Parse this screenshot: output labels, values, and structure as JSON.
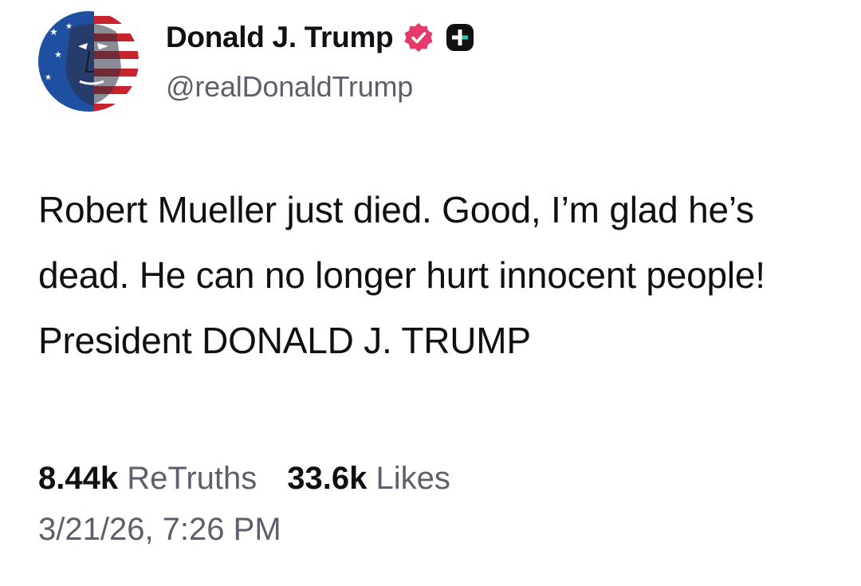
{
  "author": {
    "name": "Donald J. Trump",
    "handle": "@realDonaldTrump",
    "verified_icon": "verified-badge-icon",
    "plus_icon": "plus-badge-icon",
    "accent_color": "#e8396b"
  },
  "post": {
    "text": "Robert Mueller just died. Good, I’m glad he’s dead. He can no longer hurt innocent people! President DONALD J. TRUMP"
  },
  "stats": {
    "retruths_count": "8.44k",
    "retruths_label": "ReTruths",
    "likes_count": "33.6k",
    "likes_label": "Likes"
  },
  "timestamp": "3/21/26, 7:26 PM"
}
